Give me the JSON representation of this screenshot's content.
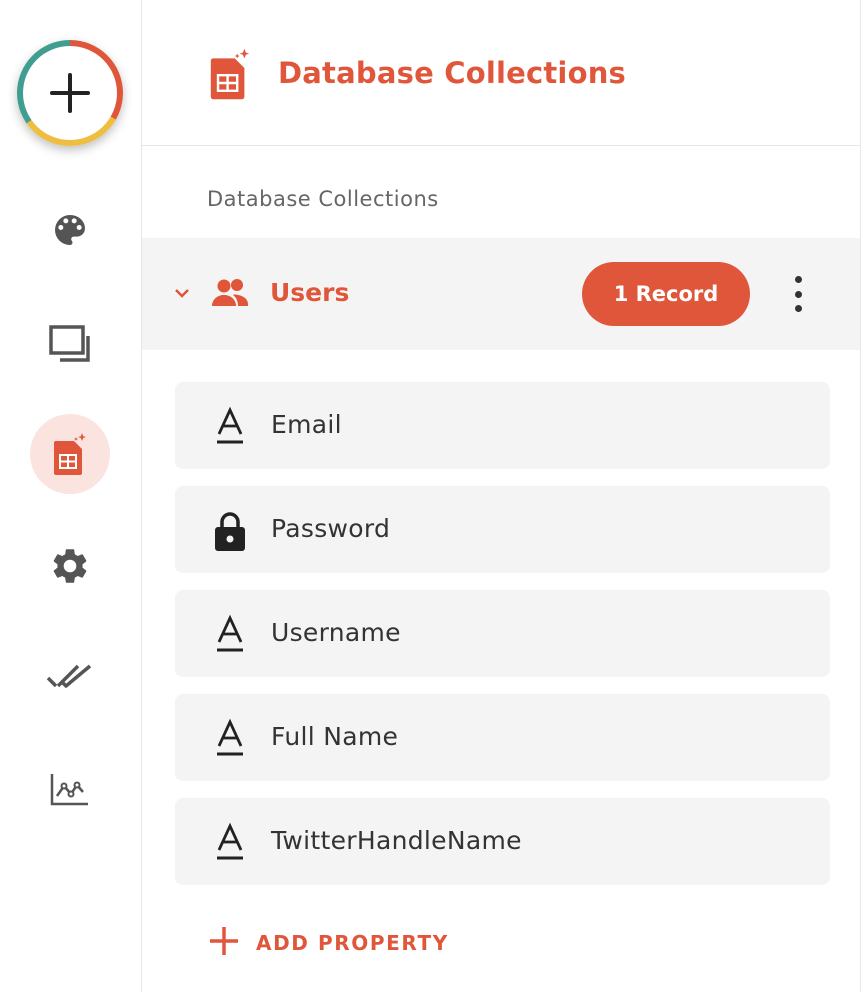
{
  "header": {
    "title": "Database Collections"
  },
  "section": {
    "label": "Database Collections"
  },
  "collection": {
    "name": "Users",
    "record_count_label": "1 Record"
  },
  "properties": [
    {
      "label": "Email",
      "icon": "text-field-icon"
    },
    {
      "label": "Password",
      "icon": "lock-icon"
    },
    {
      "label": "Username",
      "icon": "text-field-icon"
    },
    {
      "label": "Full Name",
      "icon": "text-field-icon"
    },
    {
      "label": "TwitterHandleName",
      "icon": "text-field-icon"
    }
  ],
  "actions": {
    "add_property_label": "ADD PROPERTY"
  },
  "rail": {
    "items": [
      "add-icon",
      "palette-icon",
      "screens-icon",
      "database-icon",
      "gear-icon",
      "checkmarks-icon",
      "analytics-icon"
    ],
    "active": "database-icon"
  },
  "colors": {
    "accent": "#e0563b",
    "active_bg": "#fbe3df",
    "row_bg": "#f4f4f4",
    "text": "#333333"
  }
}
